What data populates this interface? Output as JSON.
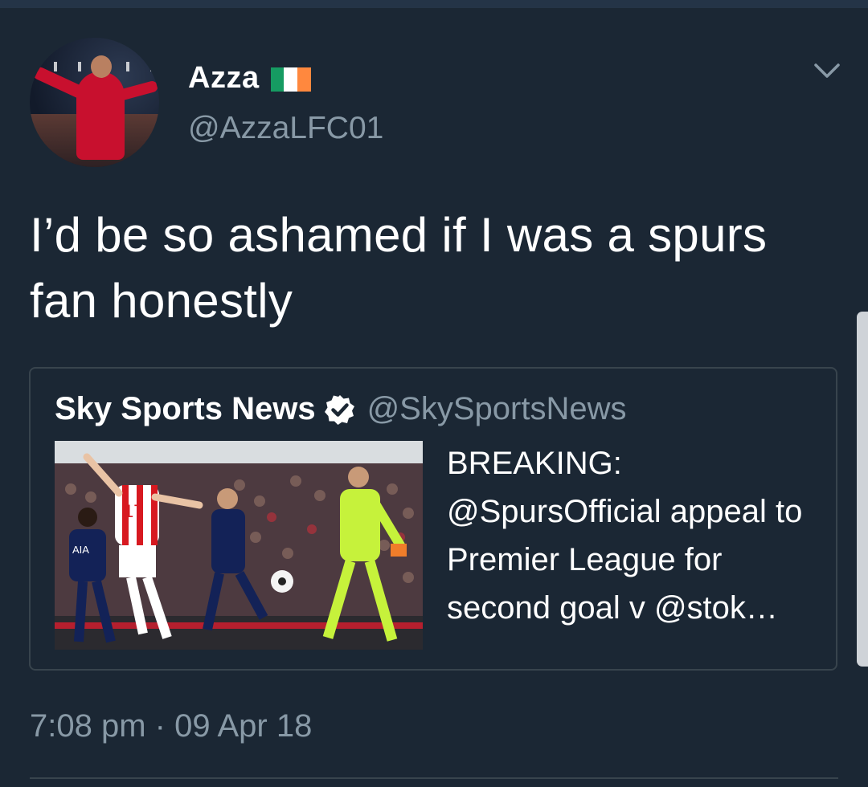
{
  "tweet": {
    "display_name": "Azza",
    "flag_icon": "ireland-flag-icon",
    "flag_colors": [
      "#169b62",
      "#ffffff",
      "#ff883e"
    ],
    "handle": "@AzzaLFC01",
    "text": "I’d be so ashamed if I was a spurs fan honestly",
    "timestamp": "7:08 pm · 09 Apr 18",
    "menu_icon": "chevron-down-icon"
  },
  "quoted_tweet": {
    "display_name": "Sky Sports News",
    "verified_icon": "verified-badge-icon",
    "handle": "@SkySportsNews",
    "text": "BREAKING: @SpursOfficial appeal to Premier League for second goal v @stok…",
    "image": {
      "shirt_number": "17",
      "sponsor_text": "AIA",
      "team_colors": [
        "#d71920",
        "#ffffff",
        "#132257",
        "#c6f23b"
      ]
    }
  },
  "colors": {
    "background": "#1b2734",
    "secondary_text": "#8899a6",
    "border": "#38444d",
    "accent": "#1da1f2"
  }
}
